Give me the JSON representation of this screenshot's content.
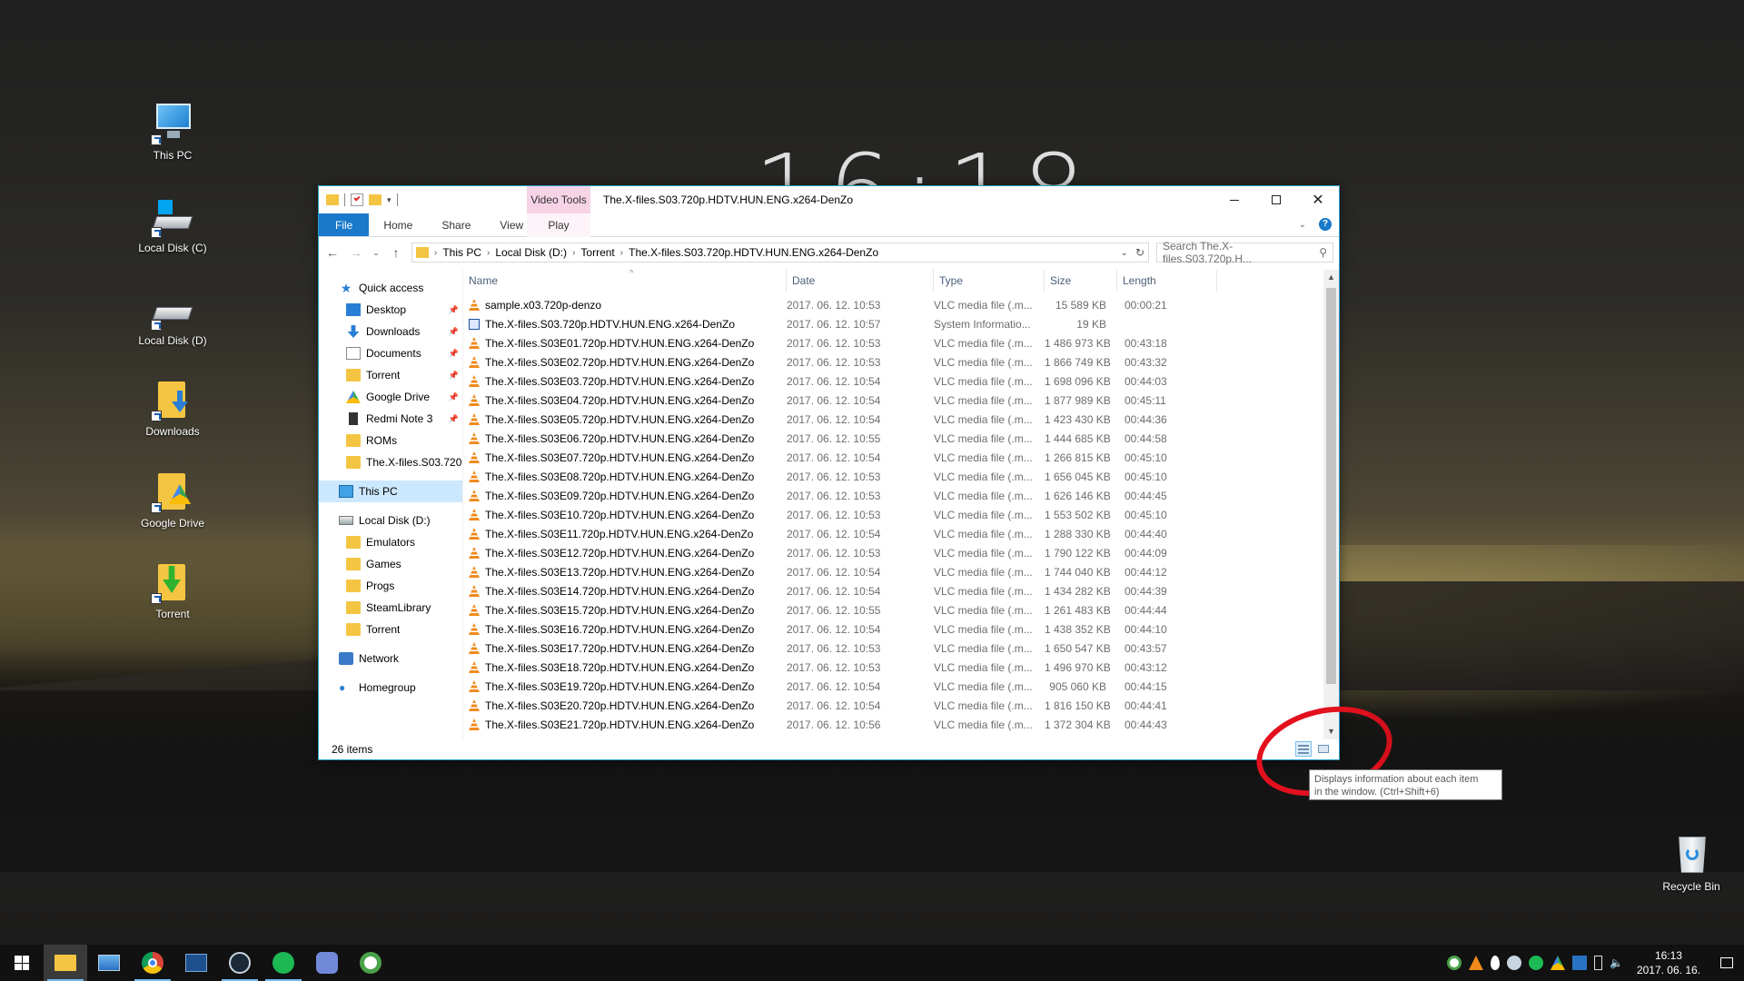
{
  "desktop": {
    "clock_overlay": "16:18",
    "icons": [
      {
        "label": "This PC"
      },
      {
        "label": "Local Disk (C)"
      },
      {
        "label": "Local Disk (D)"
      },
      {
        "label": "Downloads"
      },
      {
        "label": "Google Drive"
      },
      {
        "label": "Torrent"
      },
      {
        "label": "Recycle Bin"
      }
    ]
  },
  "window": {
    "title": "The.X-files.S03.720p.HDTV.HUN.ENG.x264-DenZo",
    "context_tab": "Video Tools",
    "ribbon_tabs": [
      "File",
      "Home",
      "Share",
      "View"
    ],
    "context_subtab": "Play",
    "breadcrumb": [
      "This PC",
      "Local Disk (D:)",
      "Torrent",
      "The.X-files.S03.720p.HDTV.HUN.ENG.x264-DenZo"
    ],
    "search_placeholder": "Search The.X-files.S03.720p.H...",
    "status": "26 items"
  },
  "navpane": {
    "quick_access": "Quick access",
    "quick_items": [
      {
        "label": "Desktop",
        "pinned": true
      },
      {
        "label": "Downloads",
        "pinned": true
      },
      {
        "label": "Documents",
        "pinned": true
      },
      {
        "label": "Torrent",
        "pinned": true
      },
      {
        "label": "Google Drive",
        "pinned": true
      },
      {
        "label": "Redmi Note 3",
        "pinned": true
      },
      {
        "label": "ROMs",
        "pinned": false
      },
      {
        "label": "The.X-files.S03.720p",
        "pinned": false
      }
    ],
    "this_pc": "This PC",
    "drive": "Local Disk (D:)",
    "drive_items": [
      "Emulators",
      "Games",
      "Progs",
      "SteamLibrary",
      "Torrent"
    ],
    "network": "Network",
    "homegroup": "Homegroup"
  },
  "columns": {
    "name": "Name",
    "date": "Date",
    "type": "Type",
    "size": "Size",
    "length": "Length"
  },
  "files": [
    {
      "name": "sample.x03.720p-denzo",
      "date": "2017. 06. 12. 10:53",
      "type": "VLC media file (.m...",
      "size": "15 589 KB",
      "length": "00:00:21",
      "icon": "vlc"
    },
    {
      "name": "The.X-files.S03.720p.HDTV.HUN.ENG.x264-DenZo",
      "date": "2017. 06. 12. 10:57",
      "type": "System Informatio...",
      "size": "19 KB",
      "length": "",
      "icon": "nfo"
    },
    {
      "name": "The.X-files.S03E01.720p.HDTV.HUN.ENG.x264-DenZo",
      "date": "2017. 06. 12. 10:53",
      "type": "VLC media file (.m...",
      "size": "1 486 973 KB",
      "length": "00:43:18",
      "icon": "vlc"
    },
    {
      "name": "The.X-files.S03E02.720p.HDTV.HUN.ENG.x264-DenZo",
      "date": "2017. 06. 12. 10:53",
      "type": "VLC media file (.m...",
      "size": "1 866 749 KB",
      "length": "00:43:32",
      "icon": "vlc"
    },
    {
      "name": "The.X-files.S03E03.720p.HDTV.HUN.ENG.x264-DenZo",
      "date": "2017. 06. 12. 10:54",
      "type": "VLC media file (.m...",
      "size": "1 698 096 KB",
      "length": "00:44:03",
      "icon": "vlc"
    },
    {
      "name": "The.X-files.S03E04.720p.HDTV.HUN.ENG.x264-DenZo",
      "date": "2017. 06. 12. 10:54",
      "type": "VLC media file (.m...",
      "size": "1 877 989 KB",
      "length": "00:45:11",
      "icon": "vlc"
    },
    {
      "name": "The.X-files.S03E05.720p.HDTV.HUN.ENG.x264-DenZo",
      "date": "2017. 06. 12. 10:54",
      "type": "VLC media file (.m...",
      "size": "1 423 430 KB",
      "length": "00:44:36",
      "icon": "vlc"
    },
    {
      "name": "The.X-files.S03E06.720p.HDTV.HUN.ENG.x264-DenZo",
      "date": "2017. 06. 12. 10:55",
      "type": "VLC media file (.m...",
      "size": "1 444 685 KB",
      "length": "00:44:58",
      "icon": "vlc"
    },
    {
      "name": "The.X-files.S03E07.720p.HDTV.HUN.ENG.x264-DenZo",
      "date": "2017. 06. 12. 10:54",
      "type": "VLC media file (.m...",
      "size": "1 266 815 KB",
      "length": "00:45:10",
      "icon": "vlc"
    },
    {
      "name": "The.X-files.S03E08.720p.HDTV.HUN.ENG.x264-DenZo",
      "date": "2017. 06. 12. 10:53",
      "type": "VLC media file (.m...",
      "size": "1 656 045 KB",
      "length": "00:45:10",
      "icon": "vlc"
    },
    {
      "name": "The.X-files.S03E09.720p.HDTV.HUN.ENG.x264-DenZo",
      "date": "2017. 06. 12. 10:53",
      "type": "VLC media file (.m...",
      "size": "1 626 146 KB",
      "length": "00:44:45",
      "icon": "vlc"
    },
    {
      "name": "The.X-files.S03E10.720p.HDTV.HUN.ENG.x264-DenZo",
      "date": "2017. 06. 12. 10:53",
      "type": "VLC media file (.m...",
      "size": "1 553 502 KB",
      "length": "00:45:10",
      "icon": "vlc"
    },
    {
      "name": "The.X-files.S03E11.720p.HDTV.HUN.ENG.x264-DenZo",
      "date": "2017. 06. 12. 10:54",
      "type": "VLC media file (.m...",
      "size": "1 288 330 KB",
      "length": "00:44:40",
      "icon": "vlc"
    },
    {
      "name": "The.X-files.S03E12.720p.HDTV.HUN.ENG.x264-DenZo",
      "date": "2017. 06. 12. 10:53",
      "type": "VLC media file (.m...",
      "size": "1 790 122 KB",
      "length": "00:44:09",
      "icon": "vlc"
    },
    {
      "name": "The.X-files.S03E13.720p.HDTV.HUN.ENG.x264-DenZo",
      "date": "2017. 06. 12. 10:54",
      "type": "VLC media file (.m...",
      "size": "1 744 040 KB",
      "length": "00:44:12",
      "icon": "vlc"
    },
    {
      "name": "The.X-files.S03E14.720p.HDTV.HUN.ENG.x264-DenZo",
      "date": "2017. 06. 12. 10:54",
      "type": "VLC media file (.m...",
      "size": "1 434 282 KB",
      "length": "00:44:39",
      "icon": "vlc"
    },
    {
      "name": "The.X-files.S03E15.720p.HDTV.HUN.ENG.x264-DenZo",
      "date": "2017. 06. 12. 10:55",
      "type": "VLC media file (.m...",
      "size": "1 261 483 KB",
      "length": "00:44:44",
      "icon": "vlc"
    },
    {
      "name": "The.X-files.S03E16.720p.HDTV.HUN.ENG.x264-DenZo",
      "date": "2017. 06. 12. 10:54",
      "type": "VLC media file (.m...",
      "size": "1 438 352 KB",
      "length": "00:44:10",
      "icon": "vlc"
    },
    {
      "name": "The.X-files.S03E17.720p.HDTV.HUN.ENG.x264-DenZo",
      "date": "2017. 06. 12. 10:53",
      "type": "VLC media file (.m...",
      "size": "1 650 547 KB",
      "length": "00:43:57",
      "icon": "vlc"
    },
    {
      "name": "The.X-files.S03E18.720p.HDTV.HUN.ENG.x264-DenZo",
      "date": "2017. 06. 12. 10:53",
      "type": "VLC media file (.m...",
      "size": "1 496 970 KB",
      "length": "00:43:12",
      "icon": "vlc"
    },
    {
      "name": "The.X-files.S03E19.720p.HDTV.HUN.ENG.x264-DenZo",
      "date": "2017. 06. 12. 10:54",
      "type": "VLC media file (.m...",
      "size": "905 060 KB",
      "length": "00:44:15",
      "icon": "vlc"
    },
    {
      "name": "The.X-files.S03E20.720p.HDTV.HUN.ENG.x264-DenZo",
      "date": "2017. 06. 12. 10:54",
      "type": "VLC media file (.m...",
      "size": "1 816 150 KB",
      "length": "00:44:41",
      "icon": "vlc"
    },
    {
      "name": "The.X-files.S03E21.720p.HDTV.HUN.ENG.x264-DenZo",
      "date": "2017. 06. 12. 10:56",
      "type": "VLC media file (.m...",
      "size": "1 372 304 KB",
      "length": "00:44:43",
      "icon": "vlc"
    }
  ],
  "tooltip": {
    "line1": "Displays information about each item",
    "line2": "in the window.  (Ctrl+Shift+6)"
  },
  "taskbar": {
    "time": "16:13",
    "date": "2017. 06. 16."
  },
  "colors": {
    "accent": "#1979ca",
    "selection": "#cce8ff",
    "annotation_red": "#e3101e",
    "video_tools": "#f7d3e6"
  }
}
